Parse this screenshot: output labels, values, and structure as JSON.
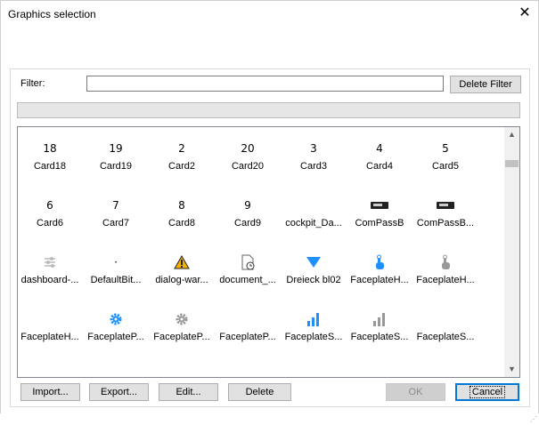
{
  "window": {
    "title": "Graphics selection",
    "close_glyph": "✕"
  },
  "filter": {
    "label": "Filter:",
    "value": "",
    "delete_label": "Delete Filter"
  },
  "grid": {
    "rows": [
      [
        {
          "icon": "18",
          "label": "Card18"
        },
        {
          "icon": "19",
          "label": "Card19"
        },
        {
          "icon": "2",
          "label": "Card2"
        },
        {
          "icon": "20",
          "label": "Card20"
        },
        {
          "icon": "3",
          "label": "Card3"
        },
        {
          "icon": "4",
          "label": "Card4"
        },
        {
          "icon": "5",
          "label": "Card5"
        }
      ],
      [
        {
          "icon": "6",
          "label": "Card6"
        },
        {
          "icon": "7",
          "label": "Card7"
        },
        {
          "icon": "8",
          "label": "Card8"
        },
        {
          "icon": "9",
          "label": "Card9"
        },
        {
          "icon": "",
          "label": "cockpit_Da..."
        },
        {
          "icon": "compass-device-icon",
          "label": "ComPassB"
        },
        {
          "icon": "compass-device-icon",
          "label": "ComPassB..."
        }
      ],
      [
        {
          "icon": "sliders-icon",
          "label": "dashboard-..."
        },
        {
          "icon": "·",
          "label": "DefaultBit..."
        },
        {
          "icon": "warning-icon",
          "label": "dialog-war..."
        },
        {
          "icon": "document-clock-icon",
          "label": "document_..."
        },
        {
          "icon": "triangle-down-icon",
          "label": "Dreieck bl02"
        },
        {
          "icon": "hand-touch-icon",
          "label": "FaceplateH..."
        },
        {
          "icon": "hand-touch-gray-icon",
          "label": "FaceplateH..."
        }
      ],
      [
        {
          "icon": "",
          "label": "FaceplateH..."
        },
        {
          "icon": "gear-blue-icon",
          "label": "FaceplateP..."
        },
        {
          "icon": "gear-gray-icon",
          "label": "FaceplateP..."
        },
        {
          "icon": "",
          "label": "FaceplateP..."
        },
        {
          "icon": "bar-chart-blue-icon",
          "label": "FaceplateS..."
        },
        {
          "icon": "bar-chart-gray-icon",
          "label": "FaceplateS..."
        },
        {
          "icon": "",
          "label": "FaceplateS..."
        }
      ]
    ]
  },
  "buttons": {
    "import": "Import...",
    "export": "Export...",
    "edit": "Edit...",
    "delete": "Delete",
    "ok": "OK",
    "cancel": "Cancel"
  },
  "scroll": {
    "up": "▲",
    "down": "▼"
  },
  "colors": {
    "accent": "#0078d7",
    "icon_blue": "#1e90ff",
    "warning": "#f2b100"
  }
}
